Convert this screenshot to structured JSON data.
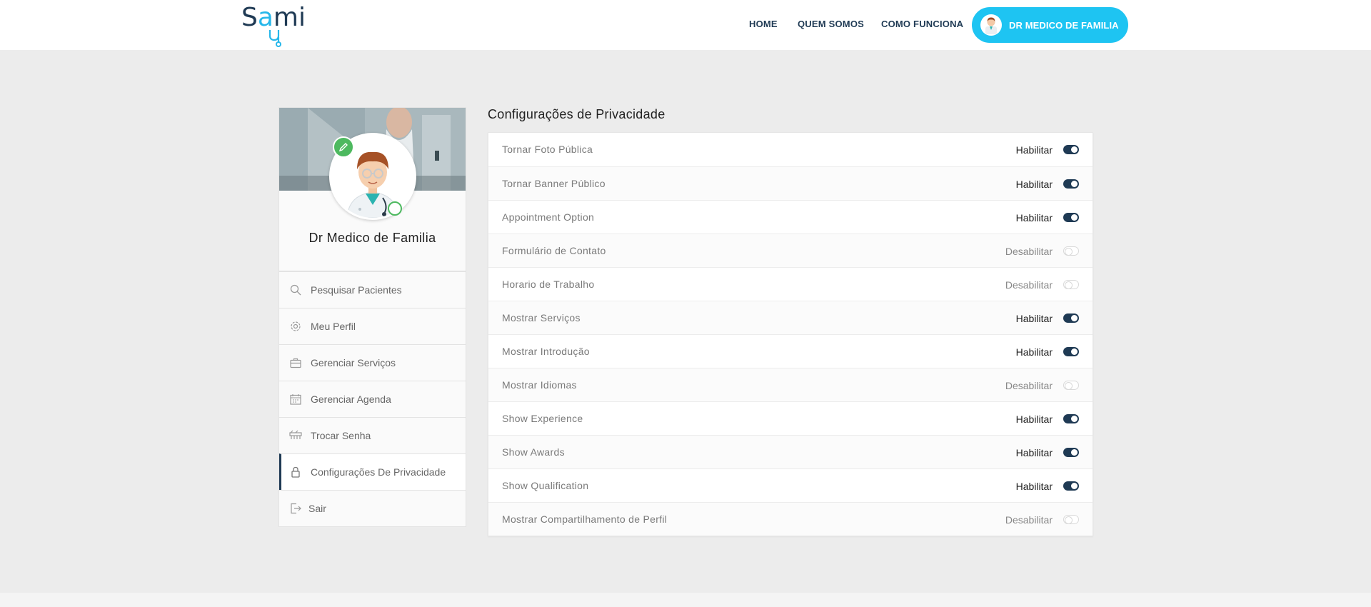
{
  "header": {
    "logo": {
      "prefix": "S",
      "mid": "a",
      "suffix": "mi",
      "accent_color": "#27b7ea",
      "primary_color": "#1f3a54"
    },
    "nav": [
      "HOME",
      "QUEM SOMOS",
      "COMO FUNCIONA"
    ],
    "user_button": {
      "label": "DR MEDICO DE FAMILIA",
      "color": "#1ec4f2",
      "icon": "doctor-avatar-icon"
    }
  },
  "profile": {
    "name": "Dr Medico de Familia",
    "edit_icon": "pencil-icon",
    "status": "online",
    "status_color": "#4db95f"
  },
  "sidebar": {
    "items": [
      {
        "label": "Pesquisar Pacientes",
        "icon": "search-icon",
        "active": false
      },
      {
        "label": "Meu Perfil",
        "icon": "gear-icon",
        "active": false
      },
      {
        "label": "Gerenciar Serviços",
        "icon": "briefcase-icon",
        "active": false
      },
      {
        "label": "Gerenciar Agenda",
        "icon": "calendar-icon",
        "active": false
      },
      {
        "label": "Trocar Senha",
        "icon": "key-icon",
        "active": false
      },
      {
        "label": "Configurações De Privacidade",
        "icon": "lock-icon",
        "active": true
      },
      {
        "label": "Sair",
        "icon": "logout-icon",
        "active": false
      }
    ]
  },
  "privacy": {
    "title": "Configurações de Privacidade",
    "settings": [
      {
        "label": "Tornar Foto Pública",
        "status": "Habilitar",
        "enabled": true
      },
      {
        "label": "Tornar Banner Público",
        "status": "Habilitar",
        "enabled": true
      },
      {
        "label": "Appointment Option",
        "status": "Habilitar",
        "enabled": true
      },
      {
        "label": "Formulário de Contato",
        "status": "Desabilitar",
        "enabled": false
      },
      {
        "label": "Horario de Trabalho",
        "status": "Desabilitar",
        "enabled": false
      },
      {
        "label": "Mostrar Serviços",
        "status": "Habilitar",
        "enabled": true
      },
      {
        "label": "Mostrar Introdução",
        "status": "Habilitar",
        "enabled": true
      },
      {
        "label": "Mostrar Idiomas",
        "status": "Desabilitar",
        "enabled": false
      },
      {
        "label": "Show Experience",
        "status": "Habilitar",
        "enabled": true
      },
      {
        "label": "Show Awards",
        "status": "Habilitar",
        "enabled": true
      },
      {
        "label": "Show Qualification",
        "status": "Habilitar",
        "enabled": true
      },
      {
        "label": "Mostrar Compartilhamento de Perfil",
        "status": "Desabilitar",
        "enabled": false
      }
    ],
    "toggle_on_color": "#1f3a54"
  }
}
